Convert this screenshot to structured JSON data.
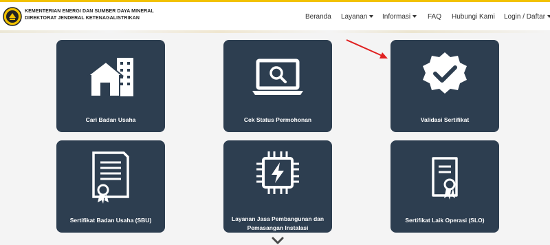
{
  "header": {
    "org_line1": "KEMENTERIAN ENERGI DAN SUMBER DAYA MINERAL",
    "org_line2": "DIREKTORAT JENDERAL KETENAGALISTRIKAN",
    "accent_color": "#f2c200"
  },
  "nav": {
    "beranda": "Beranda",
    "layanan": "Layanan",
    "informasi": "Informasi",
    "faq": "FAQ",
    "hubungi": "Hubungi Kami",
    "login": "Login / Daftar"
  },
  "cards": {
    "card_color": "#2d3e50",
    "cari_badan_usaha": "Cari Badan Usaha",
    "cek_status": "Cek Status Permohonan",
    "validasi": "Validasi Sertifikat",
    "sbu": "Sertifikat Badan Usaha (SBU)",
    "layanan_jasa_line1": "Layanan Jasa Pembangunan dan",
    "layanan_jasa_line2": "Pemasangan Instalasi",
    "slo": "Sertifikat Laik Operasi (SLO)"
  },
  "annotation": {
    "arrow_color": "#e02020"
  }
}
